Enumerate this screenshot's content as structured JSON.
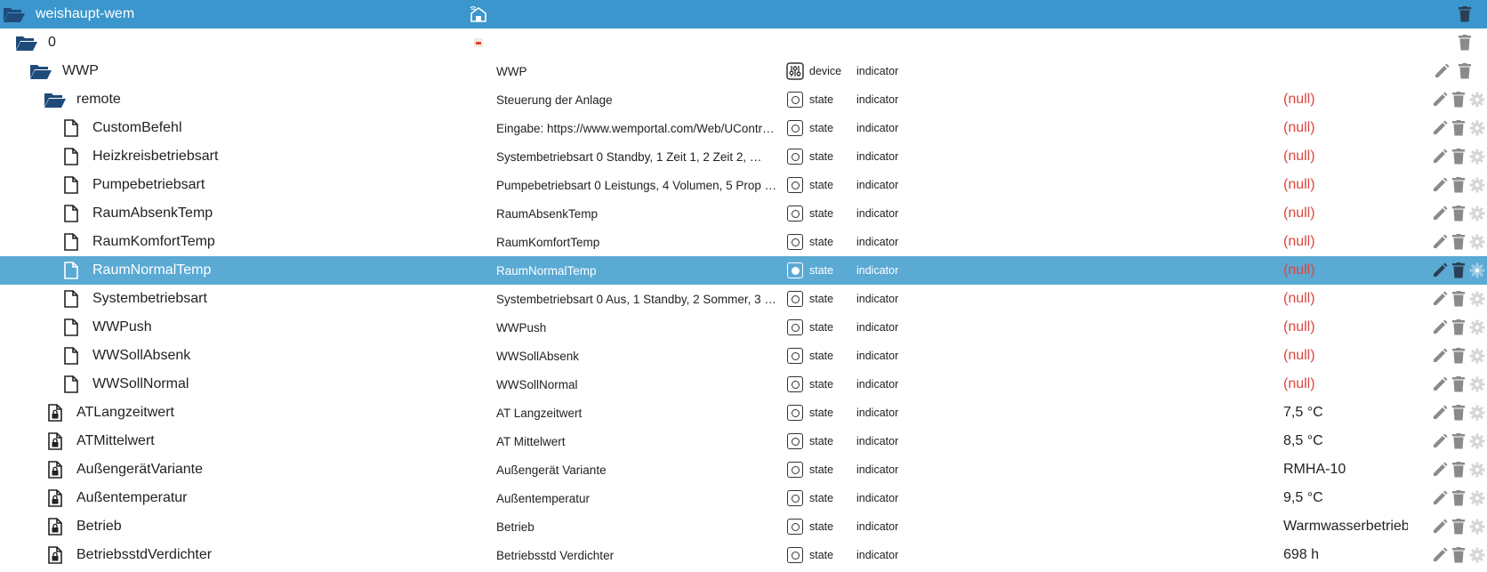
{
  "root": {
    "label": "weishaupt-wem",
    "logo_icon": "wemportal-logo-icon"
  },
  "rows": [
    {
      "label": "0",
      "description": "",
      "type_text": "",
      "role": "",
      "value": "",
      "kind": "folder",
      "level": 1
    },
    {
      "label": "WWP",
      "description": "WWP",
      "type_text": "device",
      "role": "indicator",
      "value": "",
      "kind": "folder",
      "level": 2
    },
    {
      "label": "remote",
      "description": "Steuerung der Anlage",
      "type_text": "state",
      "role": "indicator",
      "value": "(null)",
      "kind": "folder",
      "level": 3
    },
    {
      "label": "CustomBefehl",
      "description": "Eingabe: https://www.wemportal.com/Web/UContr…",
      "type_text": "state",
      "role": "indicator",
      "value": "(null)",
      "kind": "file",
      "level": 4
    },
    {
      "label": "Heizkreisbetriebsart",
      "description": "Systembetriebsart 0 Standby, 1 Zeit 1, 2 Zeit 2, …",
      "type_text": "state",
      "role": "indicator",
      "value": "(null)",
      "kind": "file",
      "level": 4
    },
    {
      "label": "Pumpebetriebsart",
      "description": "Pumpebetriebsart 0 Leistungs, 4 Volumen, 5 Prop …",
      "type_text": "state",
      "role": "indicator",
      "value": "(null)",
      "kind": "file",
      "level": 4
    },
    {
      "label": "RaumAbsenkTemp",
      "description": "RaumAbsenkTemp",
      "type_text": "state",
      "role": "indicator",
      "value": "(null)",
      "kind": "file",
      "level": 4
    },
    {
      "label": "RaumKomfortTemp",
      "description": "RaumKomfortTemp",
      "type_text": "state",
      "role": "indicator",
      "value": "(null)",
      "kind": "file",
      "level": 4
    },
    {
      "label": "RaumNormalTemp",
      "description": "RaumNormalTemp",
      "type_text": "state",
      "role": "indicator",
      "value": "(null)",
      "kind": "file",
      "level": 4,
      "selected": true
    },
    {
      "label": "Systembetriebsart",
      "description": "Systembetriebsart 0 Aus, 1 Standby, 2 Sommer, 3 …",
      "type_text": "state",
      "role": "indicator",
      "value": "(null)",
      "kind": "file",
      "level": 4
    },
    {
      "label": "WWPush",
      "description": "WWPush",
      "type_text": "state",
      "role": "indicator",
      "value": "(null)",
      "kind": "file",
      "level": 4
    },
    {
      "label": "WWSollAbsenk",
      "description": "WWSollAbsenk",
      "type_text": "state",
      "role": "indicator",
      "value": "(null)",
      "kind": "file",
      "level": 4
    },
    {
      "label": "WWSollNormal",
      "description": "WWSollNormal",
      "type_text": "state",
      "role": "indicator",
      "value": "(null)",
      "kind": "file",
      "level": 4
    },
    {
      "label": "ATLangzeitwert",
      "description": "AT Langzeitwert",
      "type_text": "state",
      "role": "indicator",
      "value": "7,5 °C",
      "kind": "locked",
      "level": 3
    },
    {
      "label": "ATMittelwert",
      "description": "AT Mittelwert",
      "type_text": "state",
      "role": "indicator",
      "value": "8,5 °C",
      "kind": "locked",
      "level": 3
    },
    {
      "label": "AußengerätVariante",
      "description": "Außengerät Variante",
      "type_text": "state",
      "role": "indicator",
      "value": "RMHA-10",
      "kind": "locked",
      "level": 3
    },
    {
      "label": "Außentemperatur",
      "description": "Außentemperatur",
      "type_text": "state",
      "role": "indicator",
      "value": "9,5 °C",
      "kind": "locked",
      "level": 3
    },
    {
      "label": "Betrieb",
      "description": "Betrieb",
      "type_text": "state",
      "role": "indicator",
      "value": "Warmwasserbetrieb",
      "kind": "locked",
      "level": 3
    },
    {
      "label": "BetriebsstdVerdichter",
      "description": "Betriebsstd Verdichter",
      "type_text": "state",
      "role": "indicator",
      "value": "698 h",
      "kind": "locked",
      "level": 3
    }
  ],
  "colors": {
    "header_bg": "#3a96cc",
    "selected_bg": "#5aaad4",
    "folder": "#1f4b7a",
    "null_value": "#d9473f",
    "action_icon": "#8a8a8a"
  }
}
